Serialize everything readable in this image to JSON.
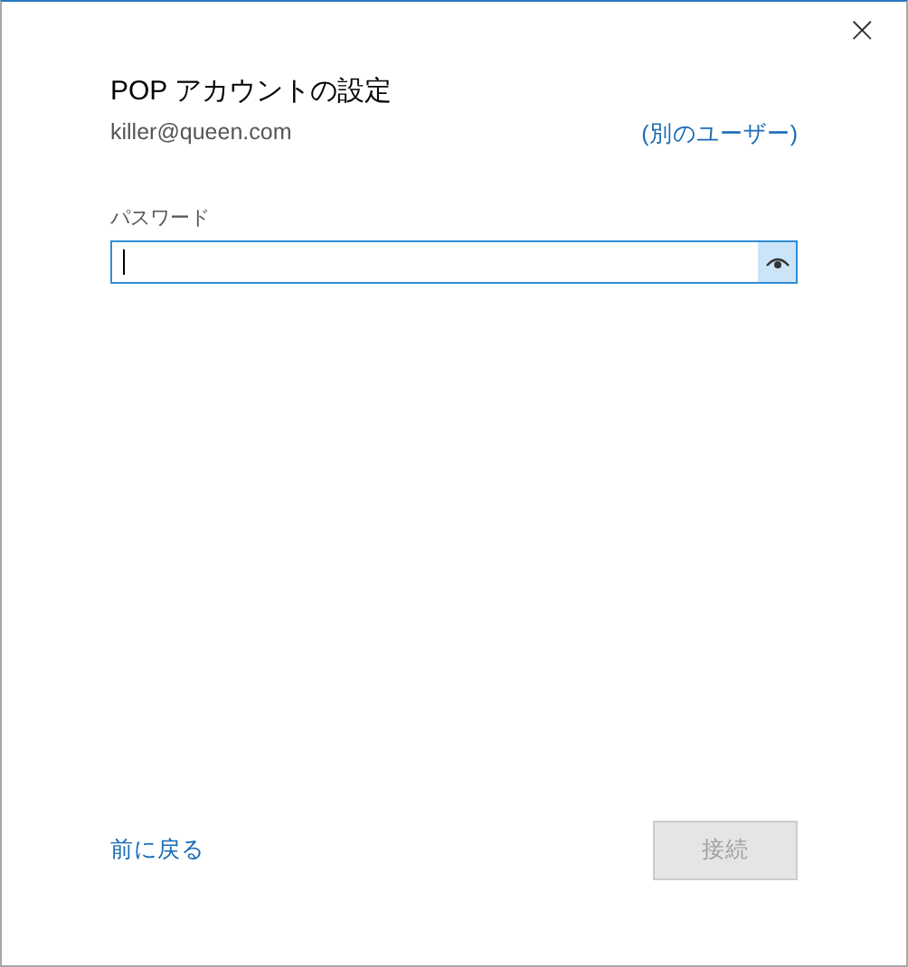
{
  "window": {
    "close": "×"
  },
  "title": "POP アカウントの設定",
  "account": {
    "email": "killer@queen.com",
    "switch_link": "(別のユーザー)"
  },
  "password": {
    "label": "パスワード",
    "focused": true
  },
  "footer": {
    "back_link": "前に戻る",
    "connect_button": {
      "label": "接続",
      "disabled": true
    }
  }
}
